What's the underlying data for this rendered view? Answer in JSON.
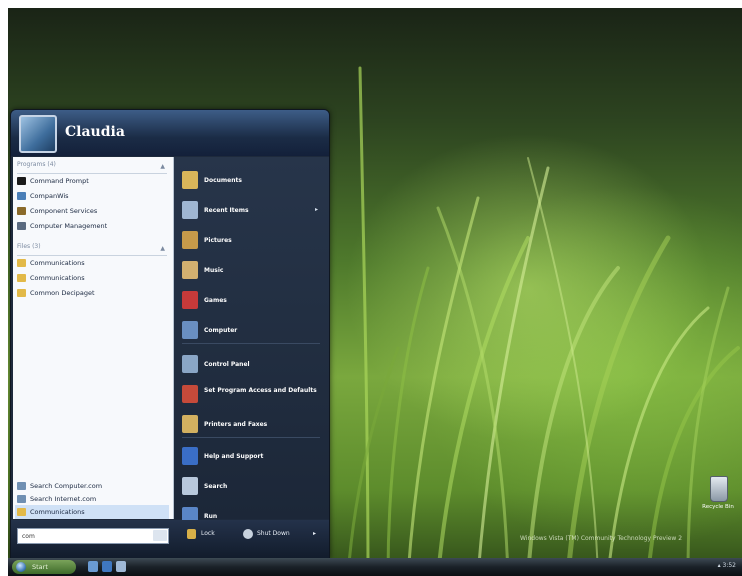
{
  "user": {
    "name": "Claudia"
  },
  "left_pane": {
    "programs_header": "Programs (4)",
    "programs": [
      {
        "label": "Command Prompt",
        "color": "#1a1a1a"
      },
      {
        "label": "CompanWis",
        "color": "#4a7fb8"
      },
      {
        "label": "Component Services",
        "color": "#8a6a2a"
      },
      {
        "label": "Computer Management",
        "color": "#5a6a80"
      }
    ],
    "files_header": "Files (3)",
    "files": [
      {
        "label": "Communications",
        "color": "#e2b948"
      },
      {
        "label": "Communications",
        "color": "#e2b948"
      },
      {
        "label": "Common Decipaget",
        "color": "#e2b948"
      }
    ],
    "search_links": [
      {
        "label": "Search Computer.com",
        "color": "#6f8fb2"
      },
      {
        "label": "Search Internet.com",
        "color": "#6f8fb2"
      },
      {
        "label": "Communications",
        "color": "#e2b948"
      }
    ]
  },
  "right_pane": {
    "items": [
      {
        "label": "Documents",
        "color": "#d9b65a"
      },
      {
        "label": "Recent Items",
        "color": "#9fb6d2",
        "arrow": "▸"
      },
      {
        "label": "Pictures",
        "color": "#c69a4a"
      },
      {
        "label": "Music",
        "color": "#d2b070"
      },
      {
        "label": "Games",
        "color": "#c63a3a"
      },
      {
        "label": "Computer",
        "color": "#6a8fc2"
      },
      {
        "label": "Control Panel",
        "color": "#8aa6c6"
      },
      {
        "label": "Set Program Access and Defaults",
        "color": "#c64a3a"
      },
      {
        "label": "Printers and Faxes",
        "color": "#d2b060"
      },
      {
        "label": "Help and Support",
        "color": "#3a6ec6"
      },
      {
        "label": "Search",
        "color": "#b8c8dc"
      },
      {
        "label": "Run",
        "color": "#5a86c6"
      }
    ]
  },
  "footer": {
    "search_value": "com",
    "lock_label": "Lock",
    "shutdown_label": "Shut Down",
    "shutdown_arrow": "▸"
  },
  "taskbar": {
    "start_label": "Start",
    "tray_text": "▴ 3:52"
  },
  "desktop": {
    "recycle_bin_label": "Recycle Bin",
    "watermark": "Windows Vista (TM) Community Technology Preview 2"
  }
}
